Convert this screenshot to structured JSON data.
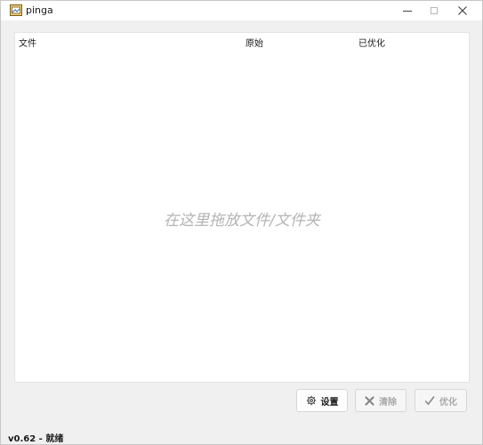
{
  "window": {
    "title": "pinga",
    "controls": {
      "minimize": "minimize",
      "maximize": "maximize",
      "close": "close"
    }
  },
  "file_list": {
    "columns": [
      "文件",
      "原始",
      "已优化"
    ],
    "rows": [],
    "drop_hint": "在这里拖放文件/文件夹"
  },
  "buttons": {
    "settings": {
      "label": "设置",
      "icon": "gear-icon",
      "enabled": true
    },
    "clear": {
      "label": "清除",
      "icon": "x-icon",
      "enabled": false
    },
    "optimize": {
      "label": "优化",
      "icon": "checkmark-icon",
      "enabled": false
    }
  },
  "status": {
    "version": "v0.62",
    "separator": " - ",
    "state": "就绪"
  }
}
